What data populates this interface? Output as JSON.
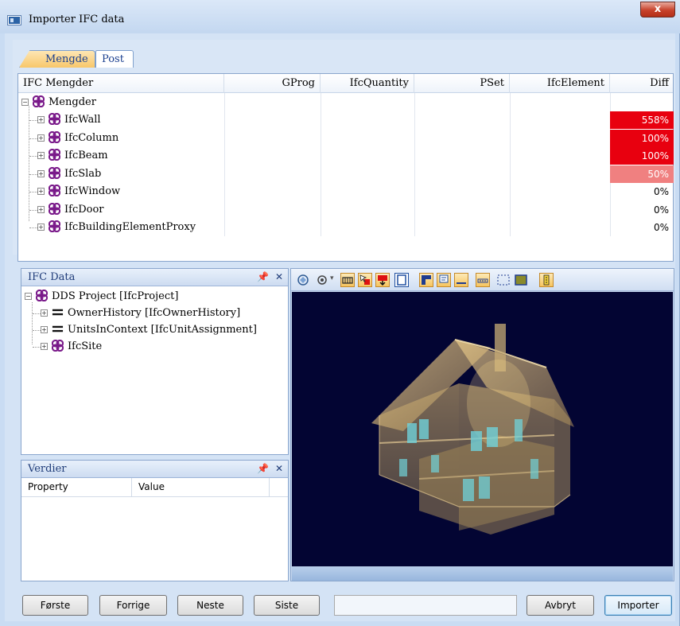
{
  "window": {
    "title": "Importer IFC data",
    "close_label": "x"
  },
  "tabs": [
    {
      "label": "Mengde"
    },
    {
      "label": "Post"
    }
  ],
  "grid": {
    "headers": [
      "IFC Mengder",
      "GProg",
      "IfcQuantity",
      "PSet",
      "IfcElement",
      "Diff"
    ],
    "root": {
      "label": "Mengder"
    },
    "rows": [
      {
        "label": "IfcWall",
        "diff": "558%",
        "diff_color": "#e8000f"
      },
      {
        "label": "IfcColumn",
        "diff": "100%",
        "diff_color": "#e8000f"
      },
      {
        "label": "IfcBeam",
        "diff": "100%",
        "diff_color": "#e8000f"
      },
      {
        "label": "IfcSlab",
        "diff": "50%",
        "diff_color": "#f08080"
      },
      {
        "label": "IfcWindow",
        "diff": "0%",
        "diff_color": ""
      },
      {
        "label": "IfcDoor",
        "diff": "0%",
        "diff_color": ""
      },
      {
        "label": "IfcBuildingElementProxy",
        "diff": "0%",
        "diff_color": ""
      }
    ]
  },
  "ifc_data": {
    "title": "IFC Data",
    "pin_icon": "pin-icon",
    "close_icon": "close-icon",
    "tree": [
      {
        "label": "DDS Project [IfcProject]",
        "icon": "ifc-object-icon"
      },
      {
        "label": "OwnerHistory [IfcOwnerHistory]",
        "icon": "equals-icon"
      },
      {
        "label": "UnitsInContext [IfcUnitAssignment]",
        "icon": "equals-icon"
      },
      {
        "label": "IfcSite",
        "icon": "ifc-object-icon"
      }
    ]
  },
  "verdier": {
    "title": "Verdier",
    "columns": [
      "Property",
      "Value"
    ]
  },
  "viewer": {
    "toolbar_icons": [
      "orbit-icon",
      "select-object-icon",
      "wall-icon",
      "arrow-select-icon",
      "door-icon",
      "window-frame-icon",
      "corner-icon",
      "comment-icon",
      "line-icon",
      "dots-icon",
      "dotted-box-icon",
      "box-icon",
      "building-icon"
    ]
  },
  "buttons": {
    "first": "Første",
    "prev": "Forrige",
    "next": "Neste",
    "last": "Siste",
    "cancel": "Avbryt",
    "import": "Importer"
  }
}
